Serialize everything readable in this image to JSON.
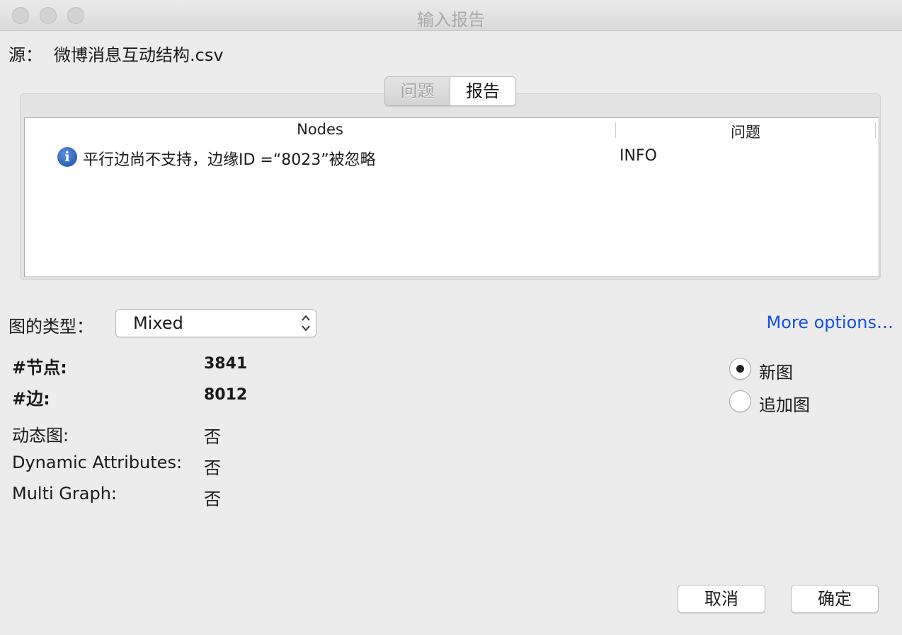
{
  "window": {
    "title": "输入报告"
  },
  "source": {
    "label": "源：",
    "filename": "微博消息互动结构.csv"
  },
  "tabs": [
    {
      "label": "问题",
      "selected": false
    },
    {
      "label": "报告",
      "selected": true
    }
  ],
  "issues_table": {
    "columns": [
      "Nodes",
      "问题"
    ],
    "rows": [
      {
        "icon": "info-icon",
        "icon_glyph": "i",
        "message": "平行边尚不支持，边缘ID =“8023”被忽略",
        "type": "INFO"
      }
    ]
  },
  "graph_type": {
    "label": "图的类型：",
    "value": "Mixed"
  },
  "more_options": "More options…",
  "stats": [
    {
      "label": "#节点:",
      "value": "3841"
    },
    {
      "label": "#边:",
      "value": "8012"
    },
    {
      "label": "动态图:",
      "value": "否"
    },
    {
      "label": "Dynamic Attributes:",
      "value": "否"
    },
    {
      "label": "Multi Graph:",
      "value": "否"
    }
  ],
  "graph_mode": {
    "options": [
      {
        "label": "新图",
        "checked": true
      },
      {
        "label": "追加图",
        "checked": false
      }
    ]
  },
  "buttons": {
    "cancel": "取消",
    "ok": "确定"
  },
  "colors": {
    "link": "#1450e0",
    "info_icon": "#1c4fa8"
  }
}
